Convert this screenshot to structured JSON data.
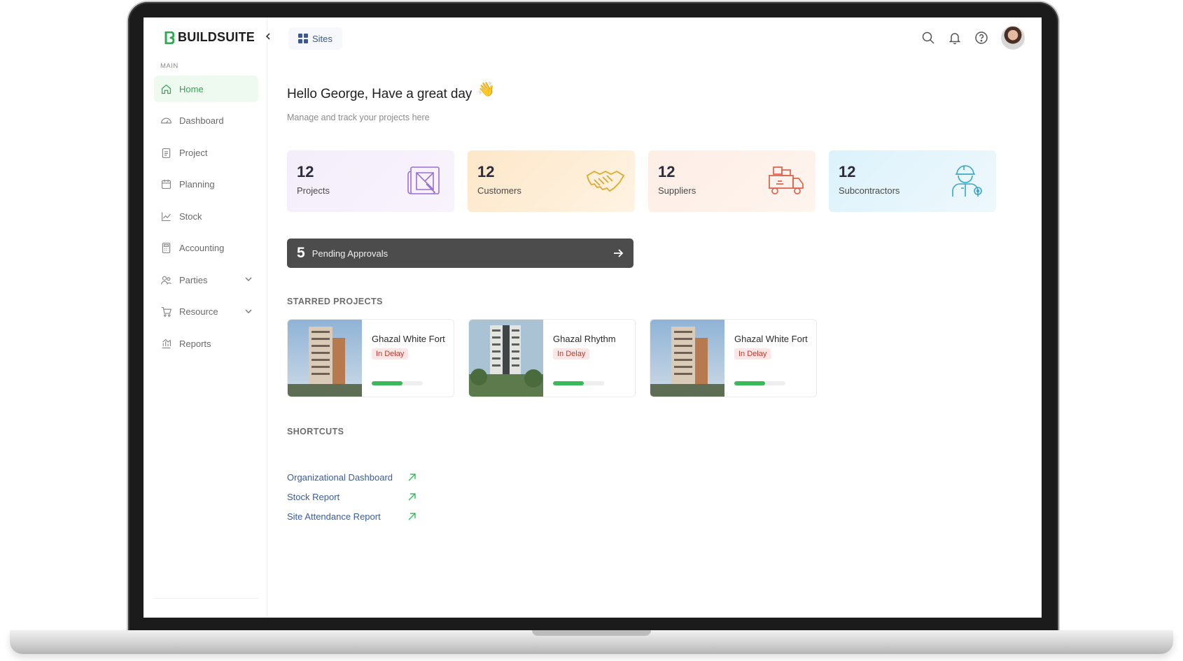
{
  "brand": {
    "name": "BUILDSUITE",
    "accent": "#2eaa52"
  },
  "sidebar": {
    "section_label": "MAIN",
    "collapse_icon": "chevron-left-icon",
    "items": [
      {
        "label": "Home",
        "icon": "home-icon",
        "active": true
      },
      {
        "label": "Dashboard",
        "icon": "gauge-icon"
      },
      {
        "label": "Project",
        "icon": "clipboard-icon"
      },
      {
        "label": "Planning",
        "icon": "calendar-icon"
      },
      {
        "label": "Stock",
        "icon": "chart-line-icon"
      },
      {
        "label": "Accounting",
        "icon": "calculator-icon"
      },
      {
        "label": "Parties",
        "icon": "users-icon",
        "expandable": true
      },
      {
        "label": "Resource",
        "icon": "cart-icon",
        "expandable": true
      },
      {
        "label": "Reports",
        "icon": "bar-chart-icon"
      }
    ]
  },
  "topbar": {
    "sites_label": "Sites",
    "icons": [
      "search-icon",
      "bell-icon",
      "help-icon",
      "avatar"
    ]
  },
  "greeting": {
    "title": "Hello George, Have a great day",
    "emoji": "👋",
    "subtitle": "Manage and track your projects here"
  },
  "stats": [
    {
      "value": "12",
      "label": "Projects",
      "icon": "blueprint-icon",
      "color": "#9b6fd6"
    },
    {
      "value": "12",
      "label": "Customers",
      "icon": "handshake-icon",
      "color": "#e0a829"
    },
    {
      "value": "12",
      "label": "Suppliers",
      "icon": "truck-icon",
      "color": "#e0624b"
    },
    {
      "value": "12",
      "label": "Subcontractors",
      "icon": "engineer-icon",
      "color": "#3aa6c9"
    }
  ],
  "pending": {
    "count": "5",
    "label": "Pending Approvals"
  },
  "starred": {
    "heading": "STARRED PROJECTS",
    "projects": [
      {
        "name": "Ghazal White Fort",
        "status": "In Delay",
        "progress": 0.6
      },
      {
        "name": "Ghazal Rhythm",
        "status": "In Delay",
        "progress": 0.6
      },
      {
        "name": "Ghazal White Fort",
        "status": "In Delay",
        "progress": 0.6
      }
    ]
  },
  "shortcuts": {
    "heading": "SHORTCUTS",
    "items": [
      {
        "label": "Organizational Dashboard"
      },
      {
        "label": "Stock Report"
      },
      {
        "label": "Site Attendance Report"
      }
    ]
  }
}
